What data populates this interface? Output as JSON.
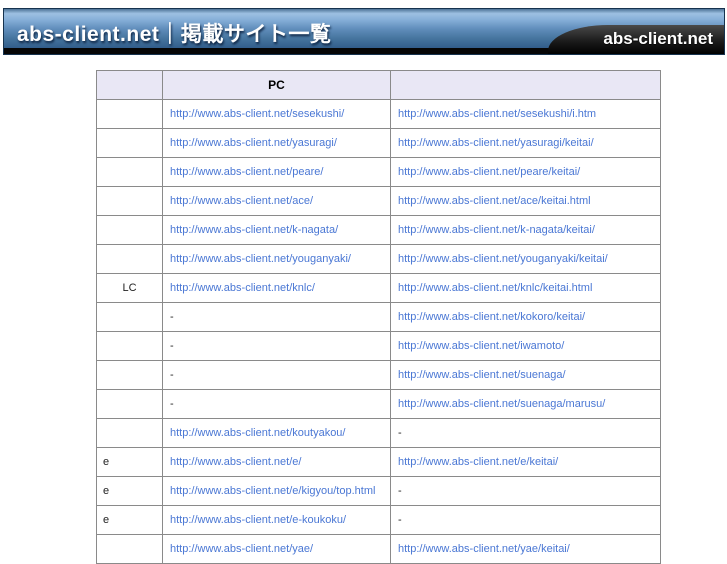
{
  "banner": {
    "title": "abs-client.net｜掲載サイト一覧",
    "logo": "abs-client.net",
    "colors": {
      "gradient_top": "#9dc0e2",
      "gradient_bottom": "#2b567f",
      "strip": "#060606",
      "corner": "#000000",
      "text": "#ffffff"
    }
  },
  "table": {
    "headers": [
      "",
      "PC",
      ""
    ],
    "colors": {
      "header_bg": "#e9e7f5",
      "border": "#8a8a8a",
      "link": "#4a77d4"
    },
    "rows": [
      {
        "label": "",
        "pc": "http://www.abs-client.net/sesekushi/",
        "mobile": "http://www.abs-client.net/sesekushi/i.htm"
      },
      {
        "label": "",
        "pc": "http://www.abs-client.net/yasuragi/",
        "mobile": "http://www.abs-client.net/yasuragi/keitai/"
      },
      {
        "label": "",
        "pc": "http://www.abs-client.net/peare/",
        "mobile": "http://www.abs-client.net/peare/keitai/"
      },
      {
        "label": "",
        "pc": "http://www.abs-client.net/ace/",
        "mobile": "http://www.abs-client.net/ace/keitai.html"
      },
      {
        "label": "",
        "pc": "http://www.abs-client.net/k-nagata/",
        "mobile": "http://www.abs-client.net/k-nagata/keitai/"
      },
      {
        "label": "",
        "pc": "http://www.abs-client.net/youganyaki/",
        "mobile": "http://www.abs-client.net/youganyaki/keitai/"
      },
      {
        "label": "LC",
        "pc": "http://www.abs-client.net/knlc/",
        "mobile": "http://www.abs-client.net/knlc/keitai.html"
      },
      {
        "label": "",
        "pc": "-",
        "mobile": "http://www.abs-client.net/kokoro/keitai/"
      },
      {
        "label": "",
        "pc": "-",
        "mobile": "http://www.abs-client.net/iwamoto/"
      },
      {
        "label": "",
        "pc": "-",
        "mobile": "http://www.abs-client.net/suenaga/"
      },
      {
        "label": "",
        "pc": "-",
        "mobile": "http://www.abs-client.net/suenaga/marusu/"
      },
      {
        "label": "",
        "pc": "http://www.abs-client.net/koutyakou/",
        "mobile": "-"
      },
      {
        "label": "e",
        "pc": "http://www.abs-client.net/e/",
        "mobile": "http://www.abs-client.net/e/keitai/"
      },
      {
        "label": "e",
        "pc": "http://www.abs-client.net/e/kigyou/top.html",
        "mobile": "-"
      },
      {
        "label": "e",
        "pc": "http://www.abs-client.net/e-koukoku/",
        "mobile": "-"
      },
      {
        "label": "",
        "pc": "http://www.abs-client.net/yae/",
        "mobile": "http://www.abs-client.net/yae/keitai/"
      }
    ]
  }
}
